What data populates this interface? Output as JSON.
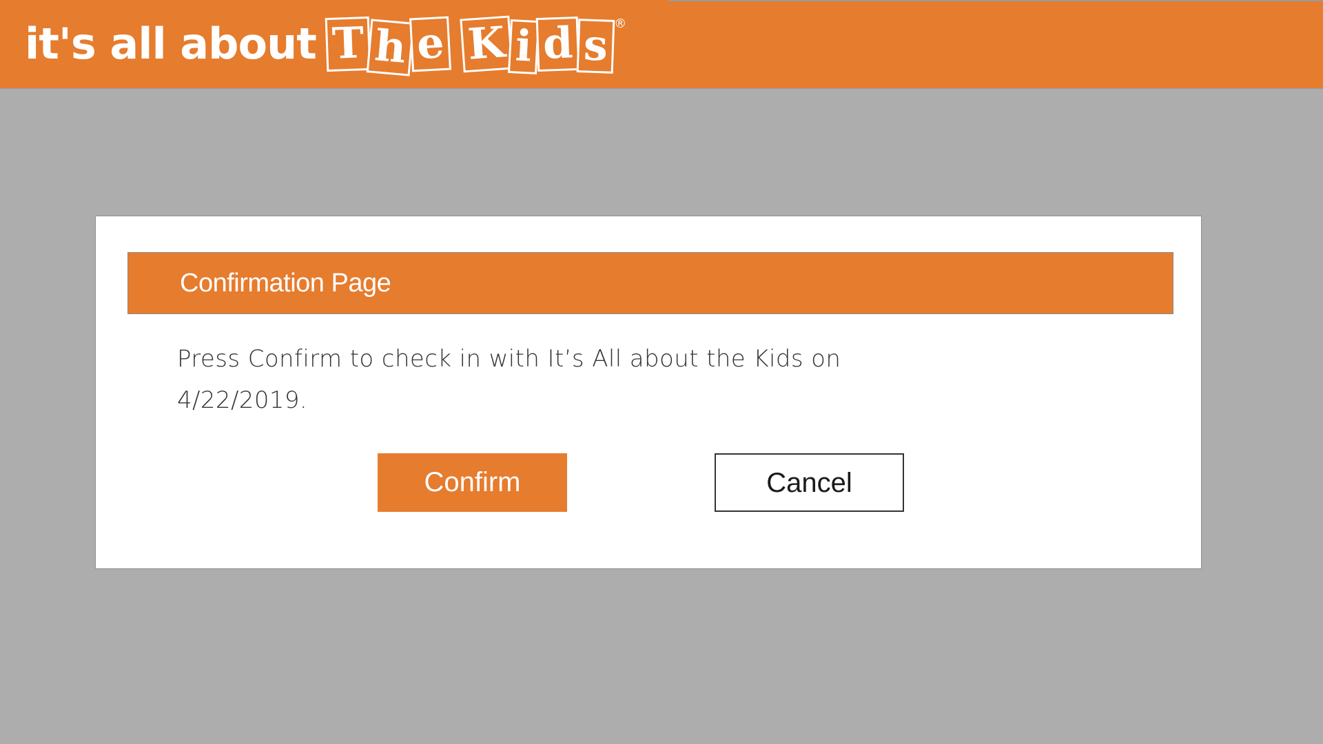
{
  "brand": {
    "text": "it's all about",
    "tiles": [
      "T",
      "h",
      "e",
      "K",
      "i",
      "d",
      "s"
    ],
    "registered": "®",
    "color": "#e67c2e"
  },
  "dialog": {
    "title": "Confirmation Page",
    "message_line1": "Press Confirm to check in with It’s All about the Kids on",
    "message_line2": "4/22/2019.",
    "confirm_label": "Confirm",
    "cancel_label": "Cancel"
  },
  "colors": {
    "accent": "#e67c2e",
    "background": "#adadad",
    "dialog_bg": "#ffffff"
  }
}
